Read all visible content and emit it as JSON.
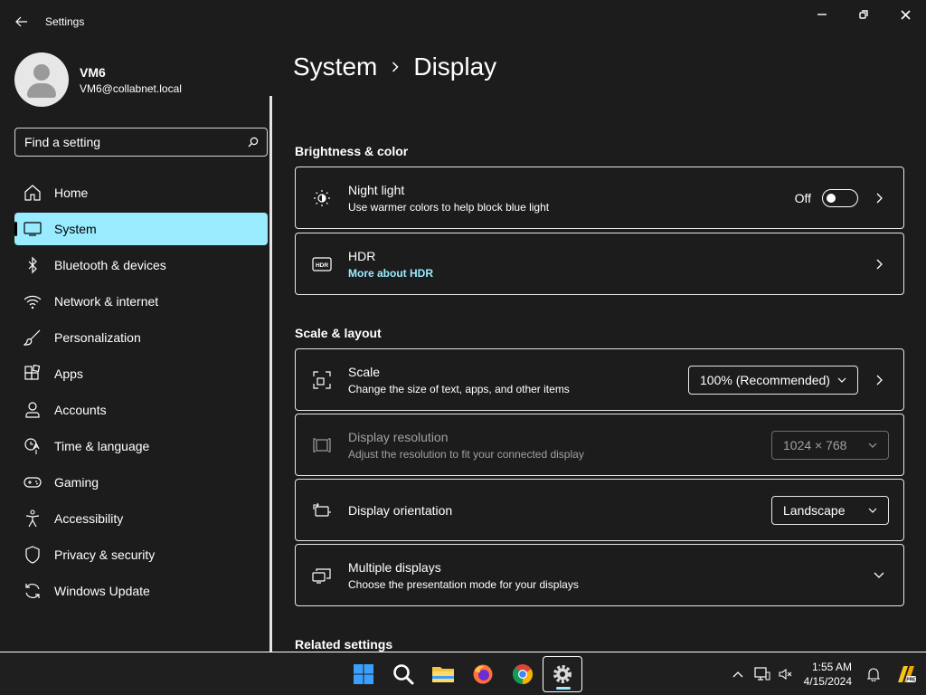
{
  "app": {
    "title": "Settings"
  },
  "profile": {
    "name": "VM6",
    "email": "VM6@collabnet.local"
  },
  "search": {
    "placeholder": "Find a setting"
  },
  "nav": [
    {
      "label": "Home",
      "icon": "home-icon"
    },
    {
      "label": "System",
      "icon": "system-icon",
      "active": true
    },
    {
      "label": "Bluetooth & devices",
      "icon": "bluetooth-icon"
    },
    {
      "label": "Network & internet",
      "icon": "wifi-icon"
    },
    {
      "label": "Personalization",
      "icon": "brush-icon"
    },
    {
      "label": "Apps",
      "icon": "apps-icon"
    },
    {
      "label": "Accounts",
      "icon": "person-icon"
    },
    {
      "label": "Time & language",
      "icon": "clock-language-icon"
    },
    {
      "label": "Gaming",
      "icon": "controller-icon"
    },
    {
      "label": "Accessibility",
      "icon": "accessibility-icon"
    },
    {
      "label": "Privacy & security",
      "icon": "shield-icon"
    },
    {
      "label": "Windows Update",
      "icon": "update-icon"
    }
  ],
  "breadcrumb": {
    "parent": "System",
    "current": "Display"
  },
  "sections": {
    "brightness": "Brightness & color",
    "scale_layout": "Scale & layout",
    "related": "Related settings"
  },
  "cards": {
    "night_light": {
      "title": "Night light",
      "sub": "Use warmer colors to help block blue light",
      "toggle_label": "Off",
      "enabled": false
    },
    "hdr": {
      "title": "HDR",
      "link": "More about HDR"
    },
    "scale": {
      "title": "Scale",
      "sub": "Change the size of text, apps, and other items",
      "value": "100% (Recommended)"
    },
    "resolution": {
      "title": "Display resolution",
      "sub": "Adjust the resolution to fit your connected display",
      "value": "1024 × 768"
    },
    "orientation": {
      "title": "Display orientation",
      "value": "Landscape"
    },
    "multiple": {
      "title": "Multiple displays",
      "sub": "Choose the presentation mode for your displays"
    }
  },
  "taskbar": {
    "apps": [
      "start-icon",
      "search-icon",
      "file-explorer-icon",
      "firefox-icon",
      "chrome-icon",
      "settings-icon"
    ],
    "time": "1:55 AM",
    "date": "4/15/2024"
  },
  "colors": {
    "accent": "#99ebff",
    "background": "#1c1c1c",
    "text": "#ffffff"
  }
}
